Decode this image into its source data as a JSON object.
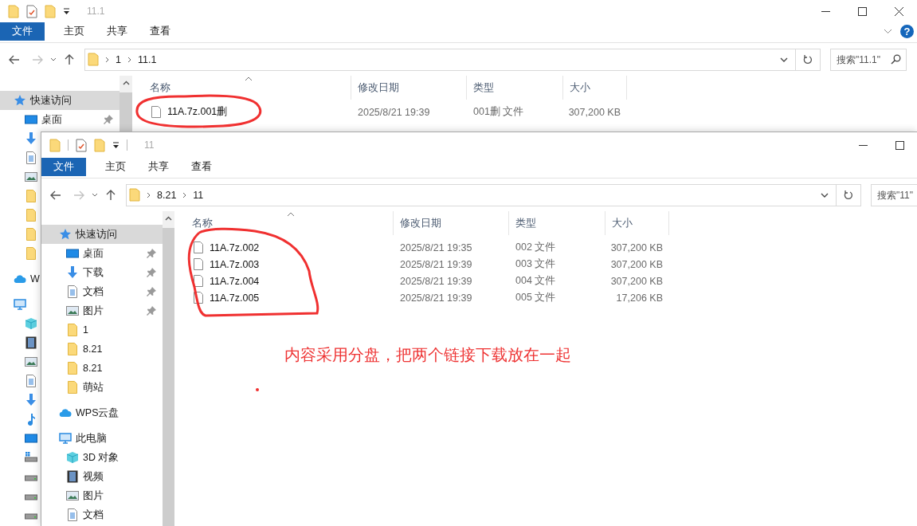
{
  "windows": [
    {
      "title": "11.1",
      "qat_separators": false,
      "caption_buttons": [
        {
          "kind": "minimize"
        },
        {
          "kind": "maximize"
        },
        {
          "kind": "close"
        }
      ],
      "ribbon_tabs": [
        {
          "label": "文件",
          "kind": "file"
        },
        {
          "label": "主页",
          "kind": "tab"
        },
        {
          "label": "共享",
          "kind": "tab"
        },
        {
          "label": "查看",
          "kind": "tab"
        }
      ],
      "help": {
        "glyph": "?"
      },
      "path": [
        "1",
        "11.1"
      ],
      "search": {
        "placeholder": "搜索\"11.1\"",
        "icon": true
      },
      "sidebar": {
        "items": [
          {
            "label": "快速访问",
            "kind": "star",
            "selected": true,
            "children": [
              {
                "label": "桌面",
                "kind": "desktop",
                "pinned": true,
                "selected": false
              },
              {
                "kind": "download",
                "selected": false
              },
              {
                "kind": "doc",
                "selected": false
              },
              {
                "kind": "picture",
                "selected": false
              },
              {
                "kind": "folder",
                "selected": false
              },
              {
                "kind": "folder",
                "selected": false
              },
              {
                "kind": "folder",
                "selected": false
              },
              {
                "kind": "folder",
                "selected": false
              }
            ]
          },
          {
            "label": "W",
            "kind": "cloud",
            "selected": false
          },
          {
            "kind": "pc",
            "selected": false,
            "children": [
              {
                "kind": "cube",
                "selected": false
              },
              {
                "kind": "video",
                "selected": false
              },
              {
                "kind": "picture",
                "selected": false
              },
              {
                "kind": "doc",
                "selected": false
              },
              {
                "kind": "download",
                "selected": false
              },
              {
                "kind": "music",
                "selected": false
              },
              {
                "kind": "desktop",
                "selected": false
              },
              {
                "kind": "drive_system",
                "selected": false
              },
              {
                "kind": "drive",
                "selected": false
              },
              {
                "kind": "drive",
                "selected": false
              },
              {
                "kind": "drive",
                "selected": false
              }
            ]
          }
        ]
      },
      "columns": [
        "名称",
        "修改日期",
        "类型",
        "大小"
      ],
      "files": [
        {
          "name": "11A.7z.001删",
          "modified": "2025/8/21 19:39",
          "type": "001删 文件",
          "size": "307,200 KB"
        }
      ]
    },
    {
      "title": "11",
      "qat_separators": true,
      "caption_buttons": [
        {
          "kind": "minimize"
        },
        {
          "kind": "maximize"
        }
      ],
      "ribbon_tabs": [
        {
          "label": "文件",
          "kind": "file"
        },
        {
          "label": "主页",
          "kind": "tab"
        },
        {
          "label": "共享",
          "kind": "tab"
        },
        {
          "label": "查看",
          "kind": "tab"
        }
      ],
      "path": [
        "8.21",
        "11"
      ],
      "search": {
        "placeholder": "搜索\"11\"",
        "icon": false
      },
      "sidebar": {
        "items": [
          {
            "label": "快速访问",
            "kind": "star",
            "selected": true,
            "children": [
              {
                "label": "桌面",
                "kind": "desktop",
                "pinned": true,
                "selected": false
              },
              {
                "label": "下载",
                "kind": "download",
                "pinned": true,
                "selected": false
              },
              {
                "label": "文档",
                "kind": "doc",
                "pinned": true,
                "selected": false
              },
              {
                "label": "图片",
                "kind": "picture",
                "pinned": true,
                "selected": false
              },
              {
                "label": "1",
                "kind": "folder",
                "pinned": false,
                "selected": false
              },
              {
                "label": "8.21",
                "kind": "folder",
                "pinned": false,
                "selected": false
              },
              {
                "label": "8.21",
                "kind": "folder",
                "pinned": false,
                "selected": false
              },
              {
                "label": "萌站",
                "kind": "folder",
                "pinned": false,
                "selected": false
              }
            ]
          },
          {
            "label": "WPS云盘",
            "kind": "cloud",
            "selected": false
          },
          {
            "label": "此电脑",
            "kind": "pc",
            "selected": false,
            "children": [
              {
                "label": "3D 对象",
                "kind": "cube",
                "selected": false
              },
              {
                "label": "视频",
                "kind": "video",
                "selected": false
              },
              {
                "label": "图片",
                "kind": "picture",
                "selected": false
              },
              {
                "label": "文档",
                "kind": "doc",
                "selected": false
              }
            ]
          }
        ]
      },
      "columns": [
        "名称",
        "修改日期",
        "类型",
        "大小"
      ],
      "files": [
        {
          "name": "11A.7z.002",
          "modified": "2025/8/21 19:35",
          "type": "002 文件",
          "size": "307,200 KB"
        },
        {
          "name": "11A.7z.003",
          "modified": "2025/8/21 19:39",
          "type": "003 文件",
          "size": "307,200 KB"
        },
        {
          "name": "11A.7z.004",
          "modified": "2025/8/21 19:39",
          "type": "004 文件",
          "size": "307,200 KB"
        },
        {
          "name": "11A.7z.005",
          "modified": "2025/8/21 19:39",
          "type": "005 文件",
          "size": "17,206 KB"
        }
      ]
    }
  ],
  "annotation": {
    "text": "内容采用分盘，把两个链接下载放在一起"
  }
}
